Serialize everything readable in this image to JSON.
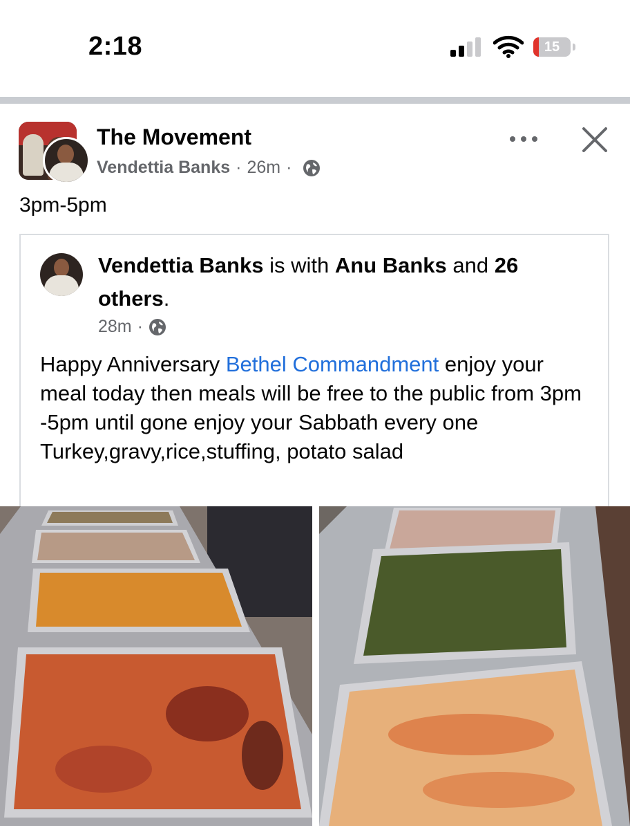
{
  "status_bar": {
    "time": "2:18",
    "battery_level": "15",
    "battery_color": "#e0342c"
  },
  "post": {
    "group_name": "The Movement",
    "author": "Vendettia Banks",
    "time_ago": "26m",
    "privacy_icon": "globe-icon",
    "text": "3pm-5pm"
  },
  "shared_post": {
    "author": "Vendettia Banks",
    "with_word": "is with",
    "tagged": "Anu Banks",
    "and_word": "and",
    "others": "26 others",
    "period": ".",
    "time_ago": "28m",
    "body_before_link": "Happy Anniversary ",
    "link": "Bethel Commandment",
    "body_after_link": " enjoy your meal today then meals will be free to the public from 3pm -5pm until gone enjoy your Sabbath every one Turkey,gravy,rice,stuffing, potato salad",
    "link_color": "#216fdb"
  },
  "icons": {
    "more": "more-dots-icon",
    "close": "close-icon"
  }
}
